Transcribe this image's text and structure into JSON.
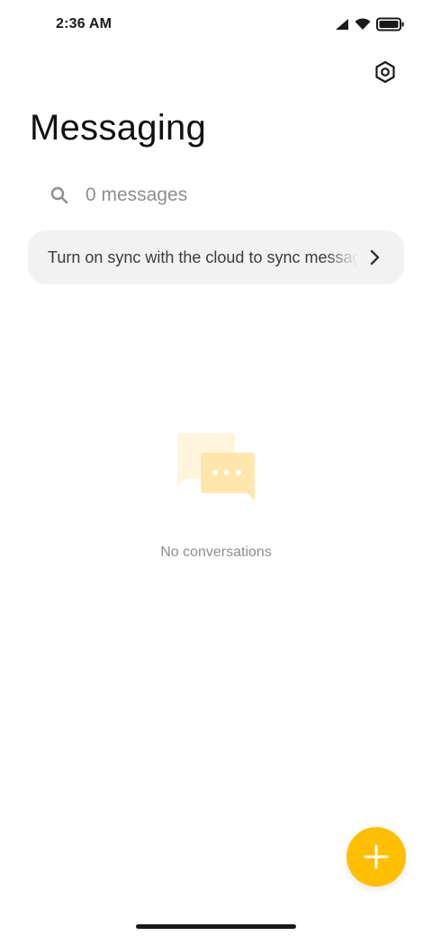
{
  "status_bar": {
    "time": "2:36 AM",
    "icons": [
      "cellular-signal-icon",
      "wifi-icon",
      "battery-icon"
    ]
  },
  "header": {
    "title": "Messaging",
    "settings_icon": "settings-hexagon-icon"
  },
  "search": {
    "icon": "search-icon",
    "placeholder": "0 messages"
  },
  "sync_banner": {
    "text": "Turn on sync with the cloud to sync messages",
    "chevron_icon": "chevron-right-icon"
  },
  "empty_state": {
    "illustration": "chat-bubbles-icon",
    "message": "No conversations"
  },
  "fab": {
    "icon": "plus-icon"
  },
  "colors": {
    "accent": "#ffbf00",
    "background": "#ffffff",
    "banner_background": "#f2f2f2",
    "secondary_text": "#8e8e8e",
    "primary_text": "#111111",
    "illustration_light": "#fff3d6",
    "illustration_mid": "#ffe4a8"
  }
}
